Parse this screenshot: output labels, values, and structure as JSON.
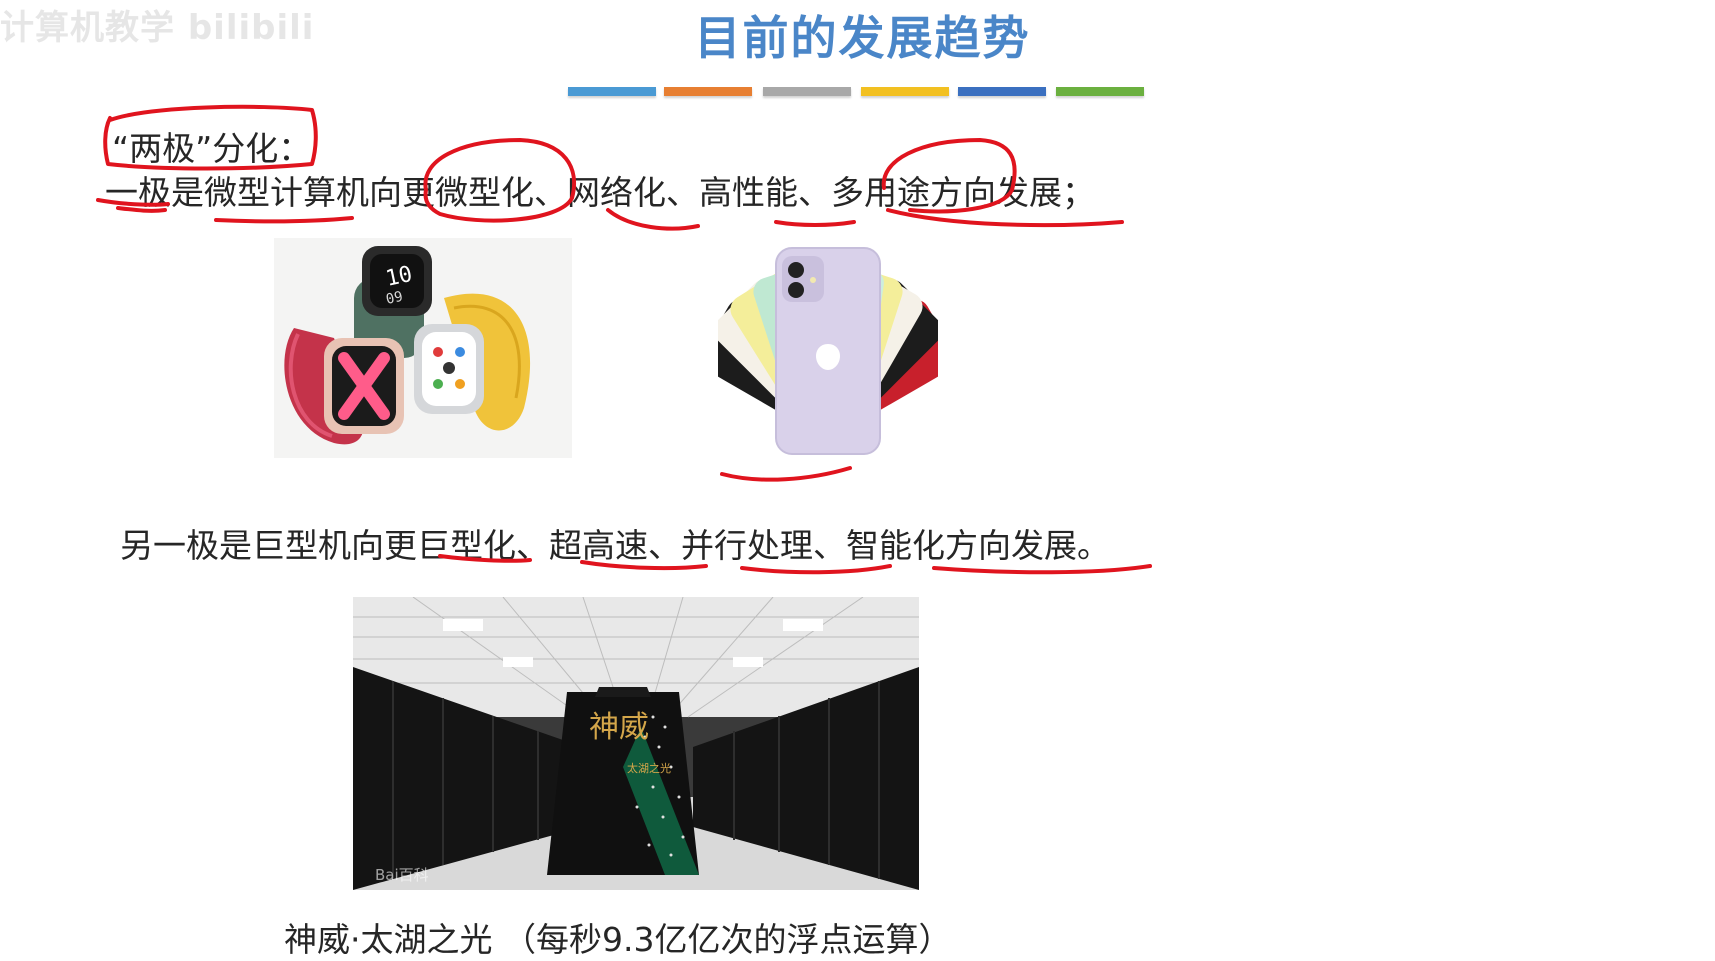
{
  "watermark": "计算机教学 bilibili",
  "slide": {
    "title": "目前的发展趋势",
    "divider_colors": [
      "#4a9ad4",
      "#e77f32",
      "#a8a8a8",
      "#f2c021",
      "#3b70c0",
      "#6bb03f"
    ],
    "heading": "“两极”分化：",
    "line1": "一极是微型计算机向更微型化、网络化、高性能、多用途方向发展；",
    "line2": "另一极是巨型机向更巨型化、超高速、并行处理、智能化方向发展。",
    "caption": "神威·太湖之光 （每秒9.3亿亿次的浮点运算）",
    "images": {
      "watches": "apple-watch-photo",
      "phones": "iphone-photo",
      "supercomputer": "supercomputer-photo",
      "supercomputer_sign_main": "神威",
      "supercomputer_sign_sub": "太湖之光",
      "baidu_watermark": "Bai百科"
    },
    "annotation_color": "#e0141e"
  }
}
